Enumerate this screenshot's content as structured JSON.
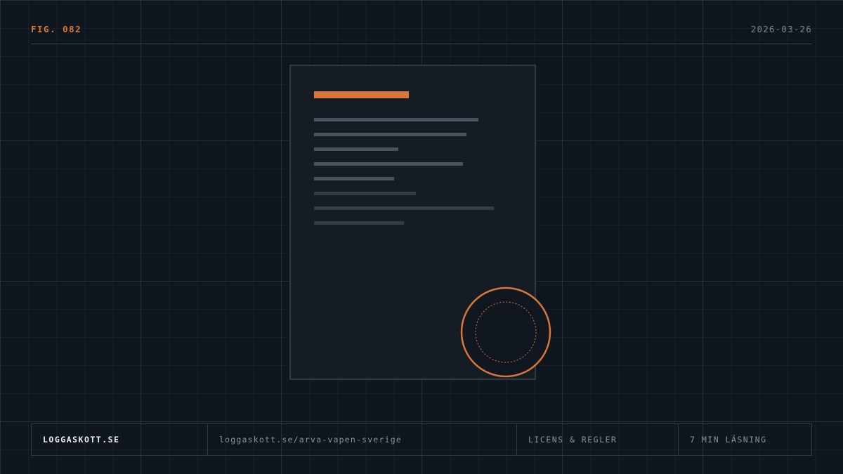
{
  "header": {
    "figure_label": "FIG. 082",
    "date": "2026-03-26"
  },
  "colors": {
    "background": "#10161e",
    "accent": "#d9773a",
    "panel": "#161c23"
  },
  "illustration": {
    "document_icon": "document-icon",
    "seal_icon": "seal-icon"
  },
  "footer": {
    "site": "LOGGASKOTT.SE",
    "url": "loggaskott.se/arva-vapen-sverige",
    "topic": "LICENS & REGLER",
    "reading_time": "7 MIN LÄSNING"
  }
}
